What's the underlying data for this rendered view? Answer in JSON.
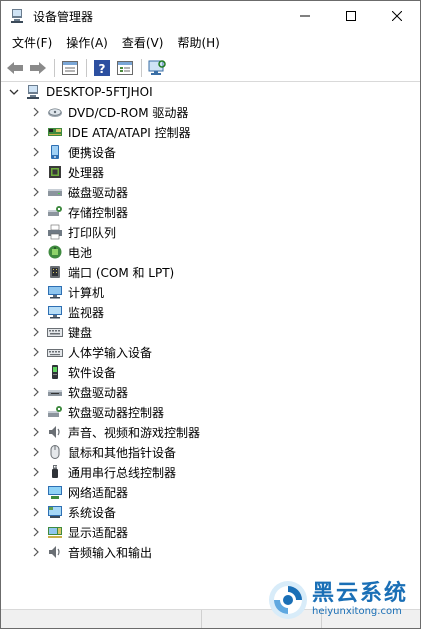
{
  "window": {
    "title": "设备管理器",
    "accent": "#1a6fb6"
  },
  "menubar": {
    "items": [
      {
        "label": "文件(F)"
      },
      {
        "label": "操作(A)"
      },
      {
        "label": "查看(V)"
      },
      {
        "label": "帮助(H)"
      }
    ]
  },
  "toolbar": {
    "buttons": [
      "back-icon",
      "forward-icon",
      "properties-view-icon",
      "help-icon",
      "list-view-icon",
      "scan-hardware-icon"
    ]
  },
  "tree": {
    "root": {
      "label": "DESKTOP-5FTJHOI",
      "expanded": true
    },
    "children": [
      {
        "label": "DVD/CD-ROM 驱动器",
        "icon": "dvd-drive-icon"
      },
      {
        "label": "IDE ATA/ATAPI 控制器",
        "icon": "ide-controller-icon"
      },
      {
        "label": "便携设备",
        "icon": "portable-device-icon"
      },
      {
        "label": "处理器",
        "icon": "processor-icon"
      },
      {
        "label": "磁盘驱动器",
        "icon": "disk-drive-icon"
      },
      {
        "label": "存储控制器",
        "icon": "storage-controller-icon"
      },
      {
        "label": "打印队列",
        "icon": "printer-icon"
      },
      {
        "label": "电池",
        "icon": "battery-icon"
      },
      {
        "label": "端口 (COM 和 LPT)",
        "icon": "port-icon"
      },
      {
        "label": "计算机",
        "icon": "computer-icon"
      },
      {
        "label": "监视器",
        "icon": "monitor-icon"
      },
      {
        "label": "键盘",
        "icon": "keyboard-icon"
      },
      {
        "label": "人体学输入设备",
        "icon": "hid-icon"
      },
      {
        "label": "软件设备",
        "icon": "software-device-icon"
      },
      {
        "label": "软盘驱动器",
        "icon": "floppy-drive-icon"
      },
      {
        "label": "软盘驱动器控制器",
        "icon": "floppy-controller-icon"
      },
      {
        "label": "声音、视频和游戏控制器",
        "icon": "sound-icon"
      },
      {
        "label": "鼠标和其他指针设备",
        "icon": "mouse-icon"
      },
      {
        "label": "通用串行总线控制器",
        "icon": "usb-icon"
      },
      {
        "label": "网络适配器",
        "icon": "network-adapter-icon"
      },
      {
        "label": "系统设备",
        "icon": "system-device-icon"
      },
      {
        "label": "显示适配器",
        "icon": "display-adapter-icon"
      },
      {
        "label": "音频输入和输出",
        "icon": "audio-io-icon"
      }
    ]
  },
  "watermark": {
    "brand": "黑云系统",
    "url": "heiyunxitong.com"
  }
}
